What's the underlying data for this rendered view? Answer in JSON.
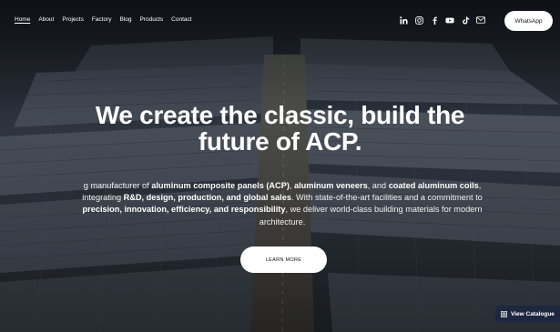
{
  "nav": {
    "links": [
      "Home",
      "About",
      "Projects",
      "Factory",
      "Blog",
      "Products",
      "Contact"
    ],
    "active": "Home"
  },
  "social": {
    "icons": [
      "linkedin-icon",
      "instagram-icon",
      "facebook-icon",
      "youtube-icon",
      "tiktok-icon",
      "email-icon"
    ]
  },
  "whatsapp": {
    "label": "WhatsApp"
  },
  "hero": {
    "headline_line1": "We create the classic, build the",
    "headline_line2": "future of ACP.",
    "desc": {
      "t1": "g manufacturer of ",
      "b1": "aluminum composite panels (ACP)",
      "t2": ", ",
      "b2": "aluminum veneers",
      "t3": ", and ",
      "b3": "coated aluminum coils",
      "t4": ", integrating ",
      "b4": "R&D, design, production, and global sales",
      "t5": ". With state-of-the-art facilities and a commitment to ",
      "b5": "precision, innovation, efficiency, and responsibility",
      "t6": ", we deliver world-class building materials for modern architecture."
    },
    "cta_label": "LEARN MORE"
  },
  "catalogue": {
    "label": "View Catalogue"
  },
  "colors": {
    "accent_dark": "#1d2740",
    "text_light": "#ffffff"
  }
}
